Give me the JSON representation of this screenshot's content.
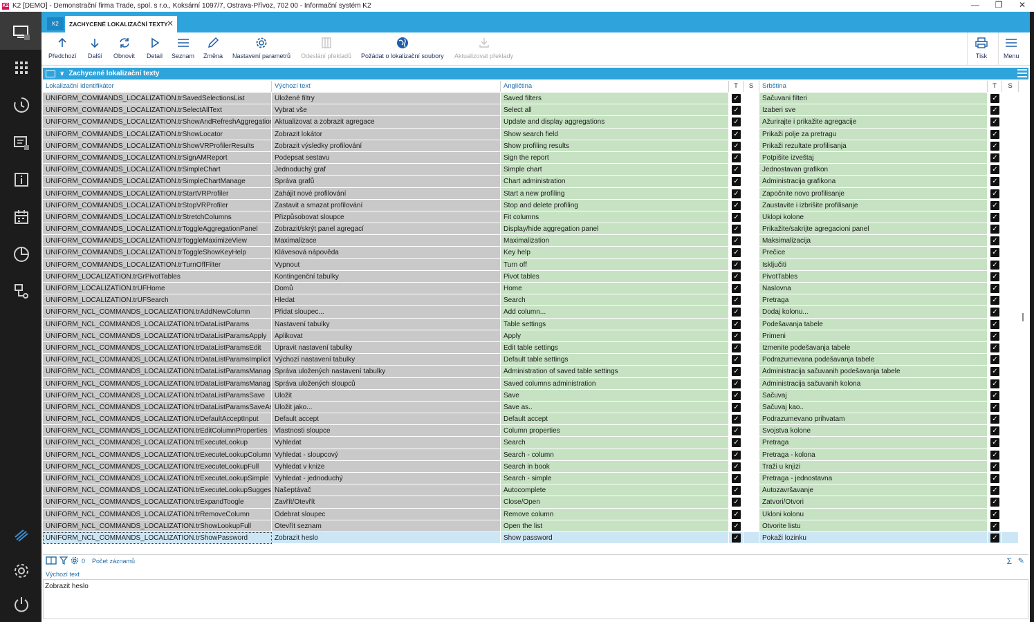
{
  "window": {
    "title": "K2 [DEMO] - Demonstrační firma Trade, spol. s r.o., Koksární 1097/7, Ostrava-Přívoz, 702 00 - Informační systém K2",
    "app_icon": "K2",
    "controls": [
      "—",
      "❐",
      "✕"
    ]
  },
  "tabs": {
    "badge": "K2",
    "active_label": "ZACHYCENÉ LOKALIZAČNÍ TEXTY",
    "close": "✕"
  },
  "toolbar": {
    "previous": "Předchozí",
    "next": "Další",
    "refresh": "Obnovit",
    "detail": "Detail",
    "list": "Seznam",
    "change": "Změna",
    "parameters": "Nastavení parametrů",
    "send_translations": "Odeslání překladů",
    "request_files": "Požádat o lokalizační soubory",
    "update_translations": "Aktualizovat překlady",
    "print": "Tisk",
    "menu": "Menu"
  },
  "grid": {
    "title": "Zachycené lokalizační texty",
    "columns": {
      "id": "Lokalizační identifikátor",
      "default": "Výchozí text",
      "english": "Angličtina",
      "t1": "T",
      "s1": "S",
      "serbian": "Srbština",
      "t2": "T",
      "s2": "S"
    },
    "rows": [
      {
        "id": "UNIFORM_COMMANDS_LOCALIZATION.trSavedSelectionsList",
        "def": "Uložené filtry",
        "en": "Saved filters",
        "sr": "Sačuvani filteri"
      },
      {
        "id": "UNIFORM_COMMANDS_LOCALIZATION.trSelectAllText",
        "def": "Vybrat vše",
        "en": "Select all",
        "sr": "Izaberi sve"
      },
      {
        "id": "UNIFORM_COMMANDS_LOCALIZATION.trShowAndRefreshAggregation",
        "def": "Aktualizovat a zobrazit agregace",
        "en": "Update and display aggregations",
        "sr": "Ažurirajte i prikažite agregacije"
      },
      {
        "id": "UNIFORM_COMMANDS_LOCALIZATION.trShowLocator",
        "def": "Zobrazit lokátor",
        "en": "Show search field",
        "sr": "Prikaži polje za pretragu"
      },
      {
        "id": "UNIFORM_COMMANDS_LOCALIZATION.trShowVRProfilerResults",
        "def": "Zobrazit výsledky profilování",
        "en": "Show profiling results",
        "sr": "Prikaži rezultate profilisanja"
      },
      {
        "id": "UNIFORM_COMMANDS_LOCALIZATION.trSignAMReport",
        "def": "Podepsat sestavu",
        "en": "Sign the report",
        "sr": "Potpišite izveštaj"
      },
      {
        "id": "UNIFORM_COMMANDS_LOCALIZATION.trSimpleChart",
        "def": "Jednoduchý graf",
        "en": "Simple chart",
        "sr": "Jednostavan grafikon"
      },
      {
        "id": "UNIFORM_COMMANDS_LOCALIZATION.trSimpleChartManage",
        "def": "Správa grafů",
        "en": "Chart administration",
        "sr": "Administracija grafikona"
      },
      {
        "id": "UNIFORM_COMMANDS_LOCALIZATION.trStartVRProfiler",
        "def": "Zahájit nové profilování",
        "en": "Start a new profiling",
        "sr": "Započnite novo profilisanje"
      },
      {
        "id": "UNIFORM_COMMANDS_LOCALIZATION.trStopVRProfiler",
        "def": "Zastavit a smazat profilování",
        "en": "Stop and delete profiling",
        "sr": "Zaustavite i izbrišite profilisanje"
      },
      {
        "id": "UNIFORM_COMMANDS_LOCALIZATION.trStretchColumns",
        "def": "Přizpůsobovat sloupce",
        "en": "Fit columns",
        "sr": "Uklopi kolone"
      },
      {
        "id": "UNIFORM_COMMANDS_LOCALIZATION.trToggleAggregationPanel",
        "def": "Zobrazit/skrýt panel agregací",
        "en": "Display/hide aggregation panel",
        "sr": "Prikažite/sakrijte agregacioni panel"
      },
      {
        "id": "UNIFORM_COMMANDS_LOCALIZATION.trToggleMaximizeView",
        "def": "Maximalizace",
        "en": "Maximalization",
        "sr": "Maksimalizacija"
      },
      {
        "id": "UNIFORM_COMMANDS_LOCALIZATION.trToggleShowKeyHelp",
        "def": "Klávesová nápověda",
        "en": "Key help",
        "sr": "Prečice"
      },
      {
        "id": "UNIFORM_COMMANDS_LOCALIZATION.trTurnOffFilter",
        "def": "Vypnout",
        "en": "Turn off",
        "sr": "Isključiti"
      },
      {
        "id": "UNIFORM_LOCALIZATION.trGrPivotTables",
        "def": "Kontingenční tabulky",
        "en": "Pivot tables",
        "sr": "PivotTables"
      },
      {
        "id": "UNIFORM_LOCALIZATION.trUFHome",
        "def": "Domů",
        "en": "Home",
        "sr": "Naslovna"
      },
      {
        "id": "UNIFORM_LOCALIZATION.trUFSearch",
        "def": "Hledat",
        "en": "Search",
        "sr": "Pretraga"
      },
      {
        "id": "UNIFORM_NCL_COMMANDS_LOCALIZATION.trAddNewColumn",
        "def": "Přidat sloupec...",
        "en": "Add column...",
        "sr": "Dodaj kolonu..."
      },
      {
        "id": "UNIFORM_NCL_COMMANDS_LOCALIZATION.trDataListParams",
        "def": "Nastavení tabulky",
        "en": "Table settings",
        "sr": "Podešavanja tabele"
      },
      {
        "id": "UNIFORM_NCL_COMMANDS_LOCALIZATION.trDataListParamsApply",
        "def": "Aplikovat",
        "en": "Apply",
        "sr": "Primeni"
      },
      {
        "id": "UNIFORM_NCL_COMMANDS_LOCALIZATION.trDataListParamsEdit",
        "def": "Upravit nastavení tabulky",
        "en": "Edit table settings",
        "sr": "Izmenite podešavanja tabele"
      },
      {
        "id": "UNIFORM_NCL_COMMANDS_LOCALIZATION.trDataListParamsImplicit",
        "def": "Výchozí nastavení tabulky",
        "en": "Default table settings",
        "sr": "Podrazumevana podešavanja tabele"
      },
      {
        "id": "UNIFORM_NCL_COMMANDS_LOCALIZATION.trDataListParamsManage",
        "def": "Správa uložených nastavení tabulky",
        "en": "Administration of saved table settings",
        "sr": "Administracija sačuvanih podešavanja tabele"
      },
      {
        "id": "UNIFORM_NCL_COMMANDS_LOCALIZATION.trDataListParamsManag...",
        "def": "Správa uložených sloupců",
        "en": "Saved columns administration",
        "sr": "Administracija sačuvanih kolona"
      },
      {
        "id": "UNIFORM_NCL_COMMANDS_LOCALIZATION.trDataListParamsSave",
        "def": "Uložit",
        "en": "Save",
        "sr": "Sačuvaj"
      },
      {
        "id": "UNIFORM_NCL_COMMANDS_LOCALIZATION.trDataListParamsSaveAs",
        "def": "Uložit jako...",
        "en": "Save as..",
        "sr": "Sačuvaj kao.."
      },
      {
        "id": "UNIFORM_NCL_COMMANDS_LOCALIZATION.trDefaultAcceptInput",
        "def": "Default accept",
        "en": "Default accept",
        "sr": "Podrazumevano prihvatam"
      },
      {
        "id": "UNIFORM_NCL_COMMANDS_LOCALIZATION.trEditColumnProperties",
        "def": "Vlastnosti sloupce",
        "en": "Column properties",
        "sr": "Svojstva kolone"
      },
      {
        "id": "UNIFORM_NCL_COMMANDS_LOCALIZATION.trExecuteLookup",
        "def": "Vyhledat",
        "en": "Search",
        "sr": "Pretraga"
      },
      {
        "id": "UNIFORM_NCL_COMMANDS_LOCALIZATION.trExecuteLookupColumns",
        "def": "Vyhledat - sloupcový",
        "en": "Search - column",
        "sr": "Pretraga - kolona"
      },
      {
        "id": "UNIFORM_NCL_COMMANDS_LOCALIZATION.trExecuteLookupFull",
        "def": "Vyhledat v knize",
        "en": "Search in book",
        "sr": "Traži u knjizi"
      },
      {
        "id": "UNIFORM_NCL_COMMANDS_LOCALIZATION.trExecuteLookupSimple",
        "def": "Vyhledat - jednoduchý",
        "en": "Search - simple",
        "sr": "Pretraga - jednostavna"
      },
      {
        "id": "UNIFORM_NCL_COMMANDS_LOCALIZATION.trExecuteLookupSuggest...",
        "def": "Našeptávač",
        "en": "Autocomplete",
        "sr": "Autozavršavanje"
      },
      {
        "id": "UNIFORM_NCL_COMMANDS_LOCALIZATION.trExpandToogle",
        "def": "Zavřít/Otevřít",
        "en": "Close/Open",
        "sr": "Zatvori/Otvori"
      },
      {
        "id": "UNIFORM_NCL_COMMANDS_LOCALIZATION.trRemoveColumn",
        "def": "Odebrat sloupec",
        "en": "Remove column",
        "sr": "Ukloni kolonu"
      },
      {
        "id": "UNIFORM_NCL_COMMANDS_LOCALIZATION.trShowLookupFull",
        "def": "Otevřít seznam",
        "en": "Open the list",
        "sr": "Otvorite listu"
      },
      {
        "id": "UNIFORM_NCL_COMMANDS_LOCALIZATION.trShowPassword",
        "def": "Zobrazit heslo",
        "en": "Show password",
        "sr": "Pokaži lozinku",
        "selected": true
      }
    ]
  },
  "footer": {
    "filter_count": "0",
    "record_count_label": "Počet záznamů",
    "sigma": "Σ",
    "edit": "✎"
  },
  "detail": {
    "label": "Výchozí text",
    "value": "Zobrazit heslo"
  },
  "colors": {
    "accent": "#2ea3dc",
    "sidebar": "#1c1c1c",
    "grey_cell": "#c9c9c9",
    "green_cell": "#c6e2c3",
    "selected_row": "#cde6f5"
  }
}
